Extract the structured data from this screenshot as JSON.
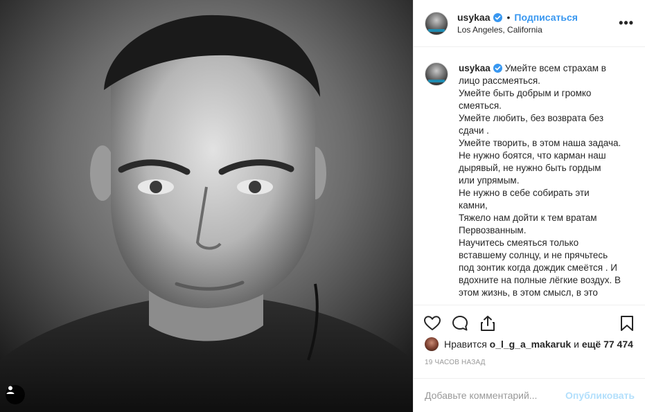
{
  "post": {
    "username": "usykaa",
    "follow_label": "Подписаться",
    "location": "Los Angeles, California",
    "more_label": "•••"
  },
  "caption": {
    "username": "usykaa",
    "lines": [
      "Умейте всем страхам в",
      "лицо рассмеяться.",
      "Умейте быть добрым и громко",
      "смеяться.",
      "Умейте любить, без возврата без",
      "сдачи .",
      "Умейте творить, в этом наша задача.",
      "Не нужно боятся, что карман наш",
      "дырявый, не нужно быть гордым",
      "или упрямым.",
      "Не нужно в себе собирать эти",
      "камни,",
      "Тяжело нам дойти к тем вратам",
      "Первозванным.",
      "Научитесь смеяться только",
      "вставшему солнцу, и не прячьтесь",
      "под зонтик когда дождик смеётся . И",
      "вдохните на полные лёгкие воздух. В",
      "этом жизнь, в этом смысл, в это"
    ]
  },
  "likes": {
    "prefix": "Нравится",
    "user": "o_l_g_a_makaruk",
    "middle": "и",
    "count_text": "ещё 77 474"
  },
  "timestamp": "19 часов назад",
  "comment": {
    "placeholder": "Добавьте комментарий...",
    "publish_label": "Опубликовать"
  },
  "colors": {
    "accent": "#3897f0",
    "verified": "#3897f0",
    "publish_disabled": "#b2dffc",
    "muted": "#999999",
    "border": "#efefef"
  },
  "icons": {
    "like": "heart-icon",
    "comment": "comment-bubble-icon",
    "share": "share-icon",
    "save": "bookmark-icon",
    "more": "more-options-icon",
    "user_tag": "user-tag-icon"
  }
}
